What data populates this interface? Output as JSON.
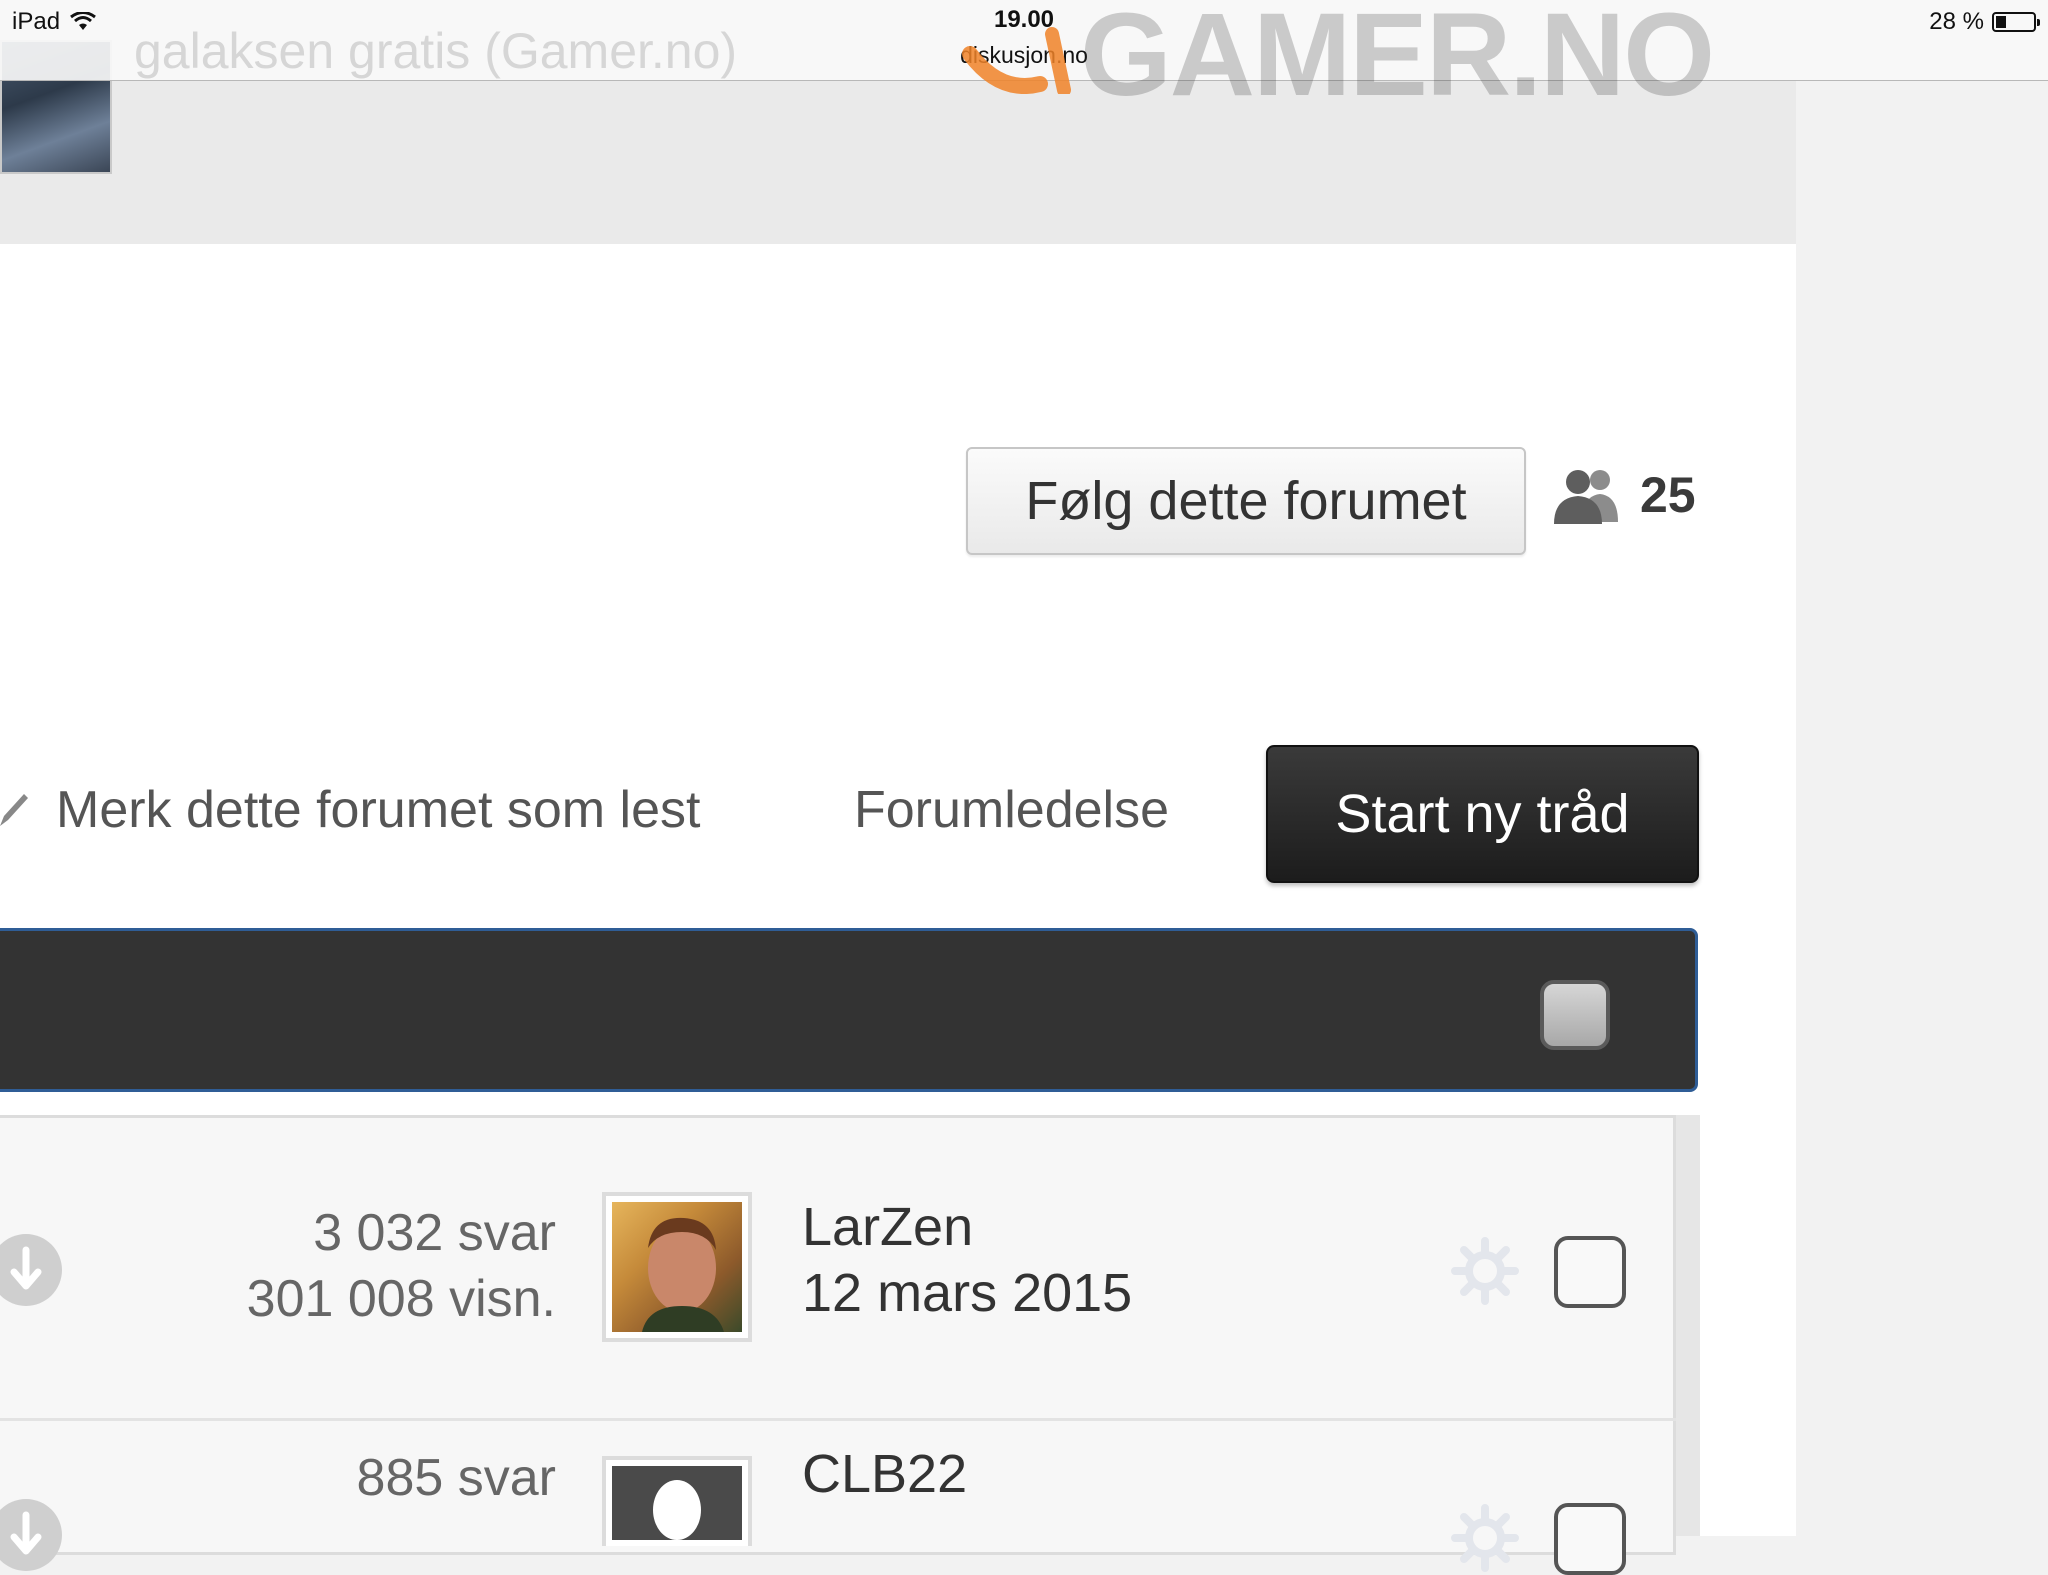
{
  "status_bar": {
    "device": "iPad",
    "time": "19.00",
    "url": "diskusjon.no",
    "battery": "28 %",
    "battery_level": 0.28
  },
  "header": {
    "news_snippet": "galaksen gratis (Gamer.no)",
    "logo_text": "GAMER.NO"
  },
  "forum": {
    "follow_button": "Følg dette forumet",
    "followers_count": "25",
    "actions": {
      "mark_read": "Merk dette forumet som lest",
      "moderators": "Forumledelse",
      "start_thread": "Start ny tråd"
    }
  },
  "threads": [
    {
      "replies": "3 032 svar",
      "views": "301 008 visn.",
      "poster": "LarZen",
      "date": "12 mars 2015",
      "avatar": "user-photo"
    },
    {
      "replies": "885 svar",
      "views": "",
      "poster": "CLB22",
      "date": "",
      "avatar": "default-avatar"
    }
  ],
  "colors": {
    "header_bg": "#eaeaea",
    "list_header_bg": "#333333",
    "list_header_border": "#2f5d96",
    "start_button_bg": "#222222"
  },
  "icons": [
    "wifi-icon",
    "battery-icon",
    "users-icon",
    "pencil-icon",
    "arrow-down-circle-icon",
    "gear-icon",
    "checkbox-icon"
  ]
}
